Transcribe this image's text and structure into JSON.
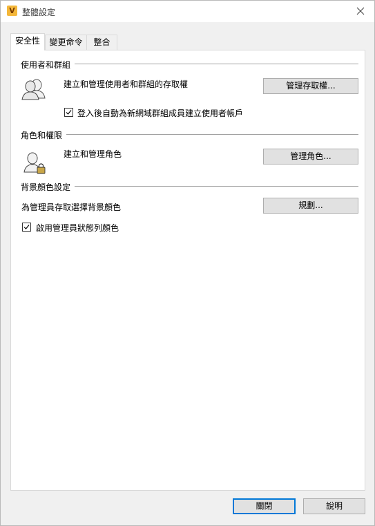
{
  "window": {
    "title": "整體設定",
    "app_icon_letter": "V"
  },
  "tabs": [
    {
      "label": "安全性",
      "active": true
    },
    {
      "label": "變更命令",
      "active": false
    },
    {
      "label": "整合",
      "active": false
    }
  ],
  "users_groups": {
    "title": "使用者和群組",
    "description": "建立和管理使用者和群組的存取權",
    "button": "管理存取權...",
    "checkbox_label": "登入後自動為新網域群組成員建立使用者帳戶",
    "checkbox_checked": true
  },
  "roles": {
    "title": "角色和權限",
    "description": "建立和管理角色",
    "button": "管理角色..."
  },
  "background": {
    "title": "背景顏色設定",
    "description": "為管理員存取選擇背景顏色",
    "button": "規劃...",
    "checkbox_label": "啟用管理員狀態列顏色",
    "checkbox_checked": true
  },
  "footer": {
    "close_label": "關閉",
    "help_label": "說明"
  }
}
